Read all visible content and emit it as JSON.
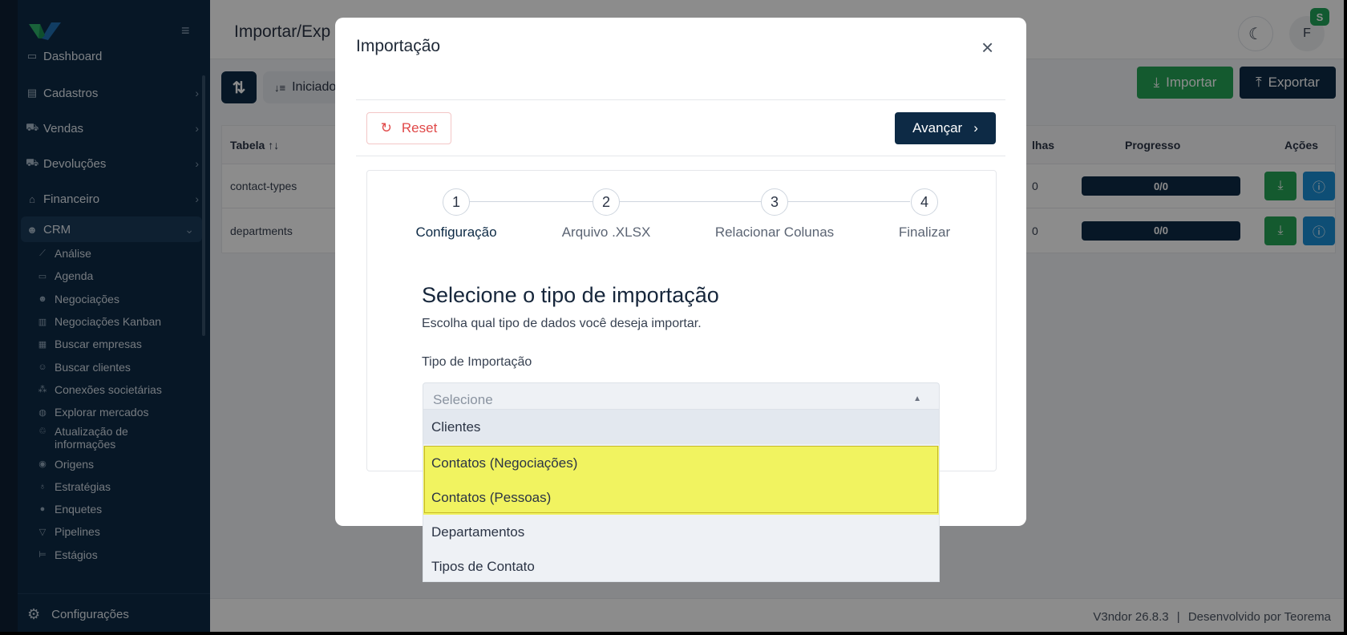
{
  "sidebar": {
    "items": [
      {
        "label": "Dashboard",
        "icon": "dashboard-icon"
      },
      {
        "label": "Cadastros",
        "icon": "register-icon"
      },
      {
        "label": "Vendas",
        "icon": "cart-icon"
      },
      {
        "label": "Devoluções",
        "icon": "cart-icon"
      },
      {
        "label": "Financeiro",
        "icon": "bank-icon"
      },
      {
        "label": "CRM",
        "icon": "users-icon"
      }
    ],
    "crm_subitems": [
      {
        "label": "Análise"
      },
      {
        "label": "Agenda"
      },
      {
        "label": "Negociações"
      },
      {
        "label": "Negociações Kanban"
      },
      {
        "label": "Buscar empresas"
      },
      {
        "label": "Buscar clientes"
      },
      {
        "label": "Conexões societárias"
      },
      {
        "label": "Explorar mercados"
      },
      {
        "label": "Atualização de informações"
      },
      {
        "label": "Origens"
      },
      {
        "label": "Estratégias"
      },
      {
        "label": "Enquetes"
      },
      {
        "label": "Pipelines"
      },
      {
        "label": "Estágios"
      }
    ],
    "footer_label": "Configurações"
  },
  "header": {
    "title": "Importar/Exp",
    "avatar_initial": "F",
    "avatar_badge": "S"
  },
  "toolbar": {
    "filter_label": "Iniciado",
    "import_label": "Importar",
    "export_label": "Exportar"
  },
  "table": {
    "columns": {
      "tabela": "Tabela",
      "linhas": "lhas",
      "progresso": "Progresso",
      "acoes": "Ações"
    },
    "rows": [
      {
        "tabela": "contact-types",
        "linhas": "0",
        "progress": "0/0"
      },
      {
        "tabela": "departments",
        "linhas": "0",
        "progress": "0/0"
      }
    ]
  },
  "footer": {
    "version": "V3ndor 26.8.3",
    "separator": "|",
    "developer": "Desenvolvido por Teorema"
  },
  "modal": {
    "title": "Importação",
    "reset_label": "Reset",
    "next_label": "Avançar",
    "steps": [
      {
        "num": "1",
        "label": "Configuração"
      },
      {
        "num": "2",
        "label": "Arquivo .XLSX"
      },
      {
        "num": "3",
        "label": "Relacionar Colunas"
      },
      {
        "num": "4",
        "label": "Finalizar"
      }
    ],
    "section_title": "Selecione o tipo de importação",
    "section_subtitle": "Escolha qual tipo de dados você deseja importar.",
    "field_label": "Tipo de Importação",
    "select_placeholder": "Selecione",
    "options": [
      {
        "label": "Clientes"
      },
      {
        "label": "Contatos (Negociações)"
      },
      {
        "label": "Contatos (Pessoas)"
      },
      {
        "label": "Departamentos"
      },
      {
        "label": "Tipos de Contato"
      }
    ]
  },
  "colors": {
    "navy": "#0d2a45",
    "green": "#25a556",
    "blue": "#1a8fd6",
    "highlight": "#f1f360",
    "reset_red": "#e04848"
  }
}
